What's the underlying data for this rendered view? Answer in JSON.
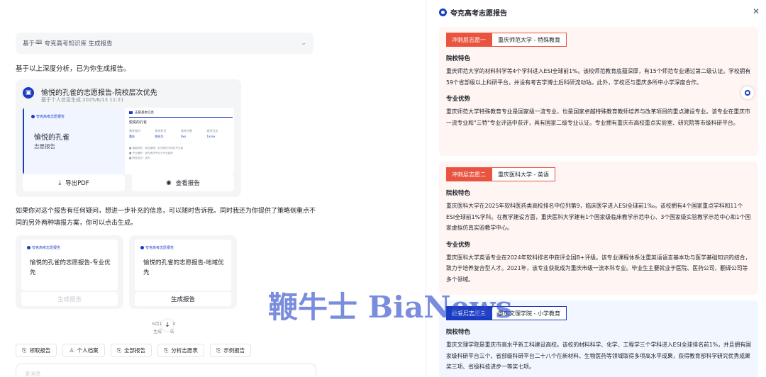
{
  "chat": {
    "kb_prefix": "基于",
    "kb_source": "夸克高考知识库 生成报告",
    "intro": "基于以上深度分析，已为你生成报告。",
    "report": {
      "title": "愉悦的孔雀的志愿报告-院校层次优先",
      "subtitle": "基于个人信息生成 2025/6/13 11:21",
      "thumb_brand": "夸克高考志愿报告",
      "thumb_name": "愉悦的孔雀",
      "thumb_kind": "志愿报告",
      "thumb_r_head": "志愿基本信息",
      "thumb_r_name": "愉悦的孔雀",
      "thumb_grid": [
        [
          "高考省份",
          "高考科目",
          "高考分数",
          "高考位次"
        ],
        [
          "重庆",
          "物化生",
          "6xx",
          "1xxxx"
        ]
      ],
      "thumb_list": [
        "■ 填报院校  · 综合推荐、补充院校与院校专业组",
        "■ 专业偏好  · 优先考虑专业与专业级别",
        "■ 院校层次  · 优先"
      ],
      "export_label": "导出PDF",
      "view_label": "查看报告"
    },
    "followup": "如果你对这个报告有任何疑问，想进一步补充的信息，可以随时告诉我。同时我还为你提供了策略侧重点不同的另外两种填报方案，你可以点击生成。",
    "plans": [
      {
        "brand": "夸克高考志愿报告",
        "title": "愉悦的孔雀的志愿报告-专业优先",
        "button": "生成报告"
      },
      {
        "brand": "夸克高考志愿报告",
        "title": "愉悦的孔雀的志愿报告-地域优先",
        "button": "生成报告"
      }
    ],
    "gen_note_1": "6月1",
    "gen_note_2": "30",
    "gen_note_3": "生成",
    "gen_note_4": "告",
    "toolbar": [
      {
        "icon": "doc-icon",
        "label": "领取报告"
      },
      {
        "icon": "user-icon",
        "label": "个人档案"
      },
      {
        "icon": "doc-icon",
        "label": "全部报告"
      },
      {
        "icon": "doc-icon",
        "label": "分析志愿表"
      },
      {
        "icon": "doc-icon",
        "label": "示例报告"
      }
    ],
    "composer_placeholder": "发消息"
  },
  "report_panel": {
    "title": "夸克高考志愿报告",
    "sections": [
      {
        "tag": "冲刺层志愿一",
        "school": "重庆师范大学 - 特殊教育",
        "blocks": [
          {
            "heading": "院校特色",
            "text": "重庆师范大学的材料科学等4个学科进入ESI全球前1%。该校师范教育底蕴深厚，有15个师范专业通过第二级认证。学校拥有59个省部级以上科研平台，并设有考古学博士后科研流动站。此外，学校还与重庆多所中小学深度合作。"
          },
          {
            "heading": "专业优势",
            "text": "重庆师范大学特殊教育专业是国家级一流专业，也是国家卓越特殊教育教师培养与改革项目的重点建设专业。该专业在重庆市一流专业和\"三特\"专业评选中获评，具有国家二级专业认证。专业拥有重庆市高校重点实验室、研究院等市级科研平台。"
          }
        ]
      },
      {
        "tag": "冲刺层志愿二",
        "school": "重庆医科大学 - 英语",
        "blocks": [
          {
            "heading": "院校特色",
            "text": "重庆医科大学在2025年软科医药类高校排名中位列第9，临床医学进入ESI全球前1‰。该校拥有4个国家重点学科和11个ESI全球前1%学科。在教学建设方面，重庆医科大学建有1个国家级临床教学示范中心、3个国家级实验教学示范中心和1个国家虚拟仿真实验教学中心。"
          },
          {
            "heading": "专业优势",
            "text": "重庆医科大学英语专业在2024年软科排名中获评全国B+评级。该专业课程体系注重英语语言基本功与医学基础知识的结合，致力于培养复合型人才。2021年，该专业获批成为重庆市级一流本科专业。毕业生主要就业于医院、医药公司、翻译公司等多个领域。"
          }
        ]
      },
      {
        "tag": "稳妥层志愿三",
        "school": "重庆文理学院 - 小学教育",
        "blocks": [
          {
            "heading": "院校特色",
            "text": "重庆文理学院是重庆市高水平新工科建设高校。该校的材料科学、化学、工程学三个学科进入ESI全球排名前1%，并且拥有国家级科研平台三个、省部级科研平台二十八个在新材料、生物医药等领域取得多项高水平成果，获得教育部科学研究优秀成果奖三项、省级科技进步一等奖七项。"
          }
        ]
      }
    ]
  },
  "watermark": "鞭牛士 BiaNews",
  "colors": {
    "brand_blue": "#1a3cc2",
    "rush_red": "#e8543f"
  }
}
